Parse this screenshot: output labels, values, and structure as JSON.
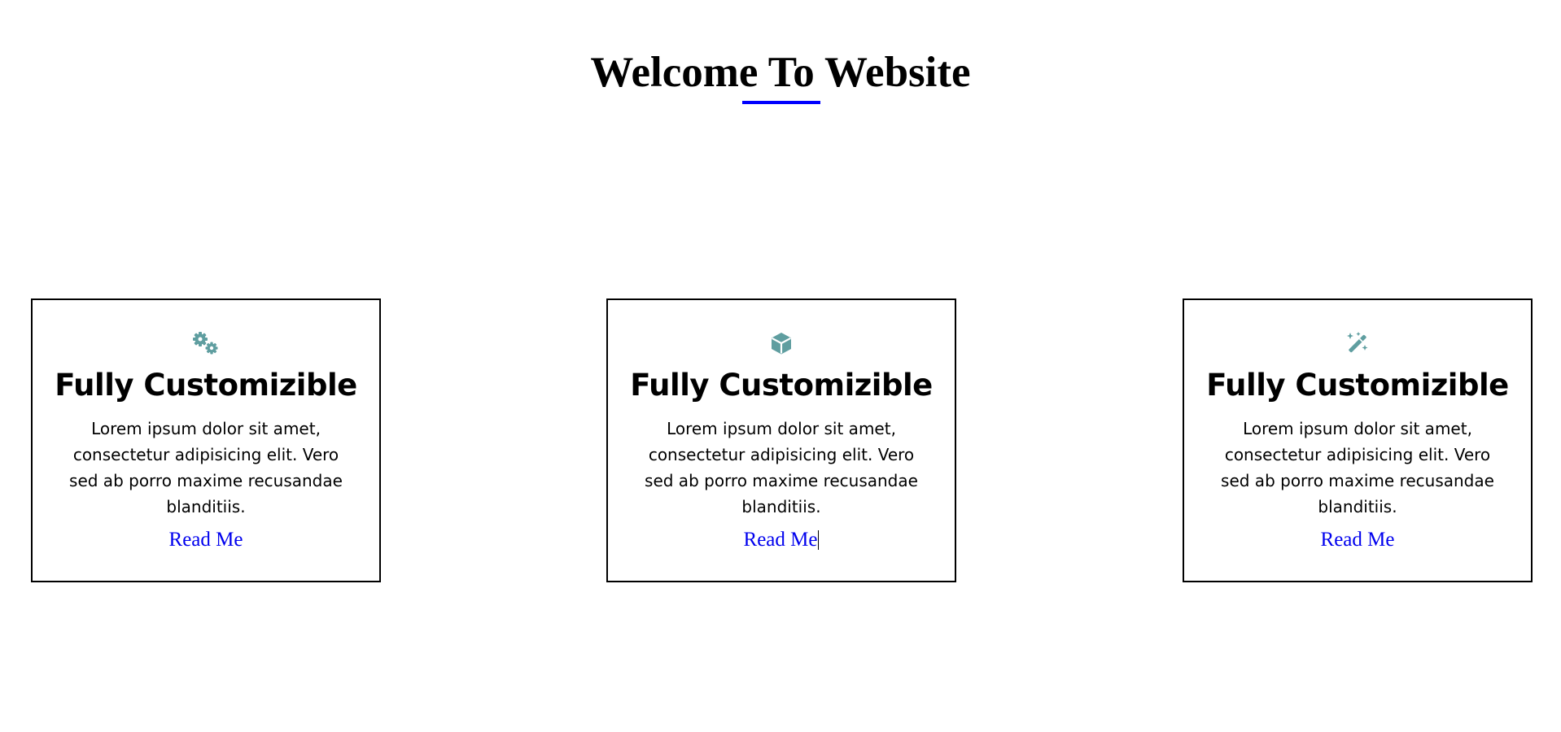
{
  "header": {
    "title": "Welcome To Website",
    "underline_color": "#0000ff"
  },
  "cards": [
    {
      "icon": "gears-icon",
      "heading": "Fully Customizible",
      "text": "Lorem ipsum dolor sit amet, consectetur adipisicing elit. Vero sed ab porro maxime recusandae blanditiis.",
      "link_label": "Read Me"
    },
    {
      "icon": "cube-icon",
      "heading": "Fully Customizible",
      "text": "Lorem ipsum dolor sit amet, consectetur adipisicing elit. Vero sed ab porro maxime recusandae blanditiis.",
      "link_label": "Read Me"
    },
    {
      "icon": "magic-wand-icon",
      "heading": "Fully Customizible",
      "text": "Lorem ipsum dolor sit amet, consectetur adipisicing elit. Vero sed ab porro maxime recusandae blanditiis.",
      "link_label": "Read Me"
    }
  ],
  "colors": {
    "icon": "#5f9ea0",
    "link": "#0000ee",
    "card_border": "#000000"
  }
}
